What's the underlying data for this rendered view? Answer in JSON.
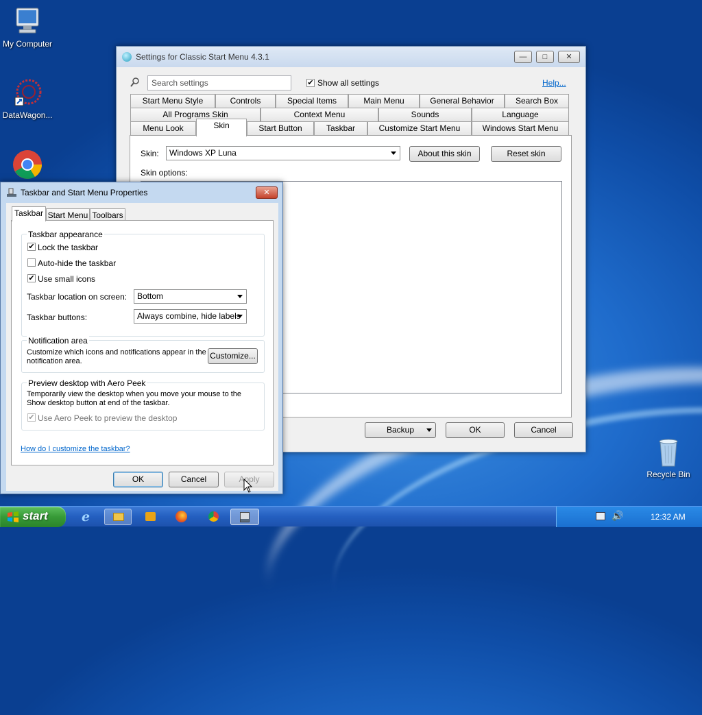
{
  "desktop": {
    "icons": [
      {
        "label": "My Computer"
      },
      {
        "label": "DataWagon..."
      },
      {
        "label": "Recycle Bin"
      }
    ]
  },
  "settings": {
    "title": "Settings for Classic Start Menu 4.3.1",
    "search_placeholder": "Search settings",
    "show_all": "Show all settings",
    "help": "Help...",
    "tabs_row1": [
      "Start Menu Style",
      "Controls",
      "Special Items",
      "Main Menu",
      "General Behavior",
      "Search Box"
    ],
    "tabs_row2": [
      "All Programs Skin",
      "Context Menu",
      "Sounds",
      "Language"
    ],
    "tabs_row3": [
      "Menu Look",
      "Skin",
      "Start Button",
      "Taskbar",
      "Customize Start Menu",
      "Windows Start Menu"
    ],
    "skin_label": "Skin:",
    "skin_value": "Windows XP Luna",
    "about_skin": "About this skin",
    "reset_skin": "Reset skin",
    "skin_options": "Skin options:",
    "backup": "Backup",
    "ok": "OK",
    "cancel": "Cancel"
  },
  "taskbar_props": {
    "title": "Taskbar and Start Menu Properties",
    "tabs": [
      "Taskbar",
      "Start Menu",
      "Toolbars"
    ],
    "appearance": "Taskbar appearance",
    "lock": "Lock the taskbar",
    "autohide": "Auto-hide the taskbar",
    "small_icons": "Use small icons",
    "location_label": "Taskbar location on screen:",
    "location_value": "Bottom",
    "buttons_label": "Taskbar buttons:",
    "buttons_value": "Always combine, hide labels",
    "notif_title": "Notification area",
    "notif_line1": "Customize which icons and notifications appear in the",
    "notif_line2": "notification area.",
    "customize": "Customize...",
    "peek_title": "Preview desktop with Aero Peek",
    "peek_line1": "Temporarily view the desktop when you move your mouse to the",
    "peek_line2": "Show desktop button at end of the taskbar.",
    "peek_cb": "Use Aero Peek to preview the desktop",
    "link": "How do I customize the taskbar?",
    "ok": "OK",
    "cancel": "Cancel",
    "apply": "Apply"
  },
  "taskbar": {
    "start": "start",
    "clock": "12:32 AM"
  }
}
